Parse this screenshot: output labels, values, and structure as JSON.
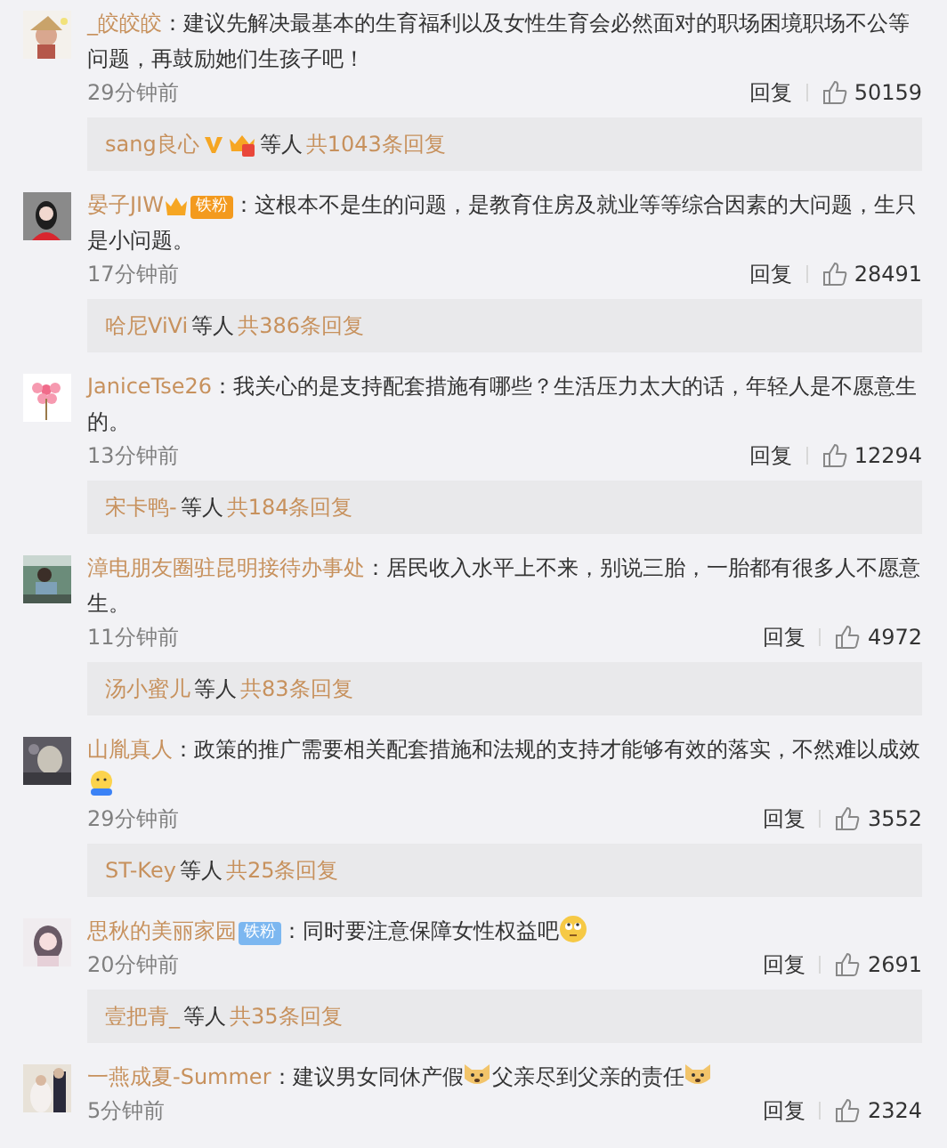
{
  "comments": [
    {
      "user": "_皎皎皎",
      "body": [
        {
          "kind": "text",
          "text": "：建议先解决最基本的生育福利以及女性生育会必然面对的职场困境职场不公等问题，再鼓励她们生孩子吧！"
        }
      ],
      "time": "29分钟前",
      "reply": "回复",
      "likes": "50159",
      "replies": {
        "user": "sang良心",
        "badges": [
          {
            "kind": "v"
          },
          {
            "kind": "crown"
          }
        ],
        "others": "等人",
        "count": "共1043条回复"
      }
    },
    {
      "user": "晏子JIW",
      "badges": [
        {
          "kind": "crown-fan",
          "label": "铁粉"
        }
      ],
      "body": [
        {
          "kind": "text",
          "text": "：这根本不是生的问题，是教育住房及就业等等综合因素的大问题，生只是小问题。"
        }
      ],
      "time": "17分钟前",
      "reply": "回复",
      "likes": "28491",
      "replies": {
        "user": "哈尼ViVi",
        "others": "等人",
        "count": "共386条回复"
      }
    },
    {
      "user": "JaniceTse26",
      "body": [
        {
          "kind": "text",
          "text": "：我关心的是支持配套措施有哪些？生活压力太大的话，年轻人是不愿意生的。"
        }
      ],
      "time": "13分钟前",
      "reply": "回复",
      "likes": "12294",
      "replies": {
        "user": "宋卡鸭-",
        "others": "等人",
        "count": "共184条回复"
      }
    },
    {
      "user": "漳电朋友圈驻昆明接待办事处",
      "body": [
        {
          "kind": "text",
          "text": "：居民收入水平上不来，别说三胎，一胎都有很多人不愿意生。"
        }
      ],
      "time": "11分钟前",
      "reply": "回复",
      "likes": "4972",
      "replies": {
        "user": "汤小蜜儿",
        "others": "等人",
        "count": "共83条回复"
      }
    },
    {
      "user": "山胤真人",
      "body": [
        {
          "kind": "text",
          "text": "：政策的推广需要相关配套措施和法规的支持才能够有效的落实，不然难以成效"
        },
        {
          "kind": "hug"
        }
      ],
      "time": "29分钟前",
      "reply": "回复",
      "likes": "3552",
      "replies": {
        "user": "ST-Key",
        "others": "等人",
        "count": "共25条回复"
      }
    },
    {
      "user": "思秋的美丽家园",
      "badges": [
        {
          "kind": "fan",
          "label": "铁粉"
        }
      ],
      "body": [
        {
          "kind": "text",
          "text": "：同时要注意保障女性权益吧"
        },
        {
          "kind": "eyeroll"
        }
      ],
      "time": "20分钟前",
      "reply": "回复",
      "likes": "2691",
      "replies": {
        "user": "壹把青_",
        "others": "等人",
        "count": "共35条回复"
      }
    },
    {
      "user": "一燕成夏-Summer",
      "body": [
        {
          "kind": "text",
          "text": "：建议男女同休产假"
        },
        {
          "kind": "dog"
        },
        {
          "kind": "text",
          "text": "父亲尽到父亲的责任"
        },
        {
          "kind": "dog"
        }
      ],
      "time": "5分钟前",
      "reply": "回复",
      "likes": "2324"
    }
  ]
}
